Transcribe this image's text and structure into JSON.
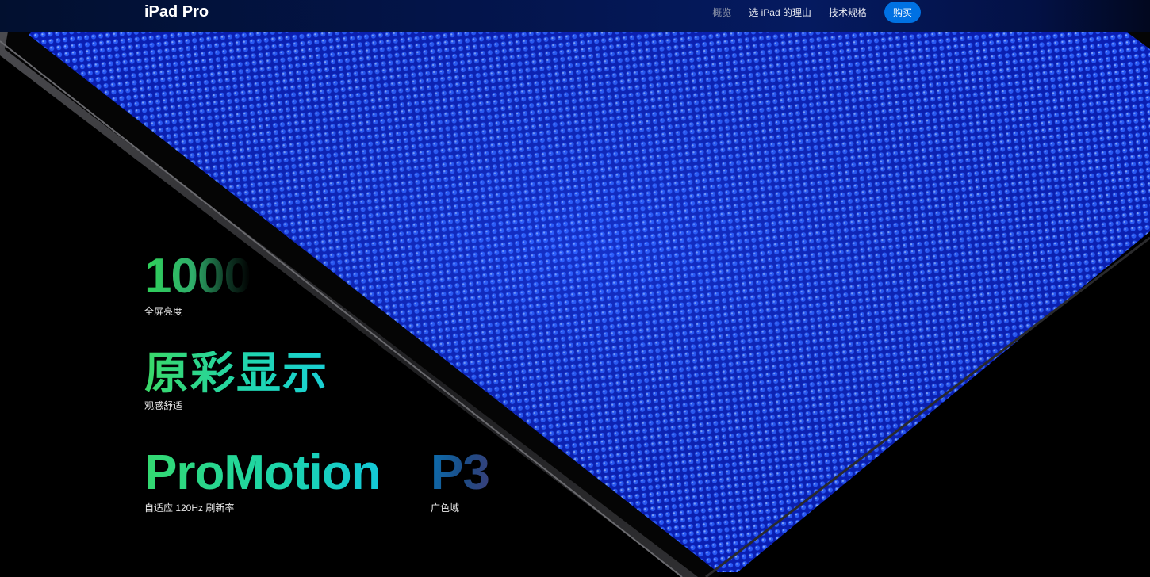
{
  "nav": {
    "title": "iPad Pro",
    "links": [
      "概览",
      "选 iPad 的理由",
      "技术规格"
    ],
    "buy_label": "购买"
  },
  "features": {
    "brightness": {
      "value": "1000",
      "caption": "全屏亮度"
    },
    "color": {
      "value": "原彩显示",
      "caption": "观感舒适"
    },
    "promotion": {
      "value": "ProMotion",
      "caption": "自适应 120Hz 刷新率"
    },
    "p3": {
      "value": "P3",
      "caption": "广色域"
    }
  },
  "colors": {
    "nav_bg": "#03144a",
    "buy_button": "#0071e3",
    "pixel_glow": "#1a4dff"
  }
}
